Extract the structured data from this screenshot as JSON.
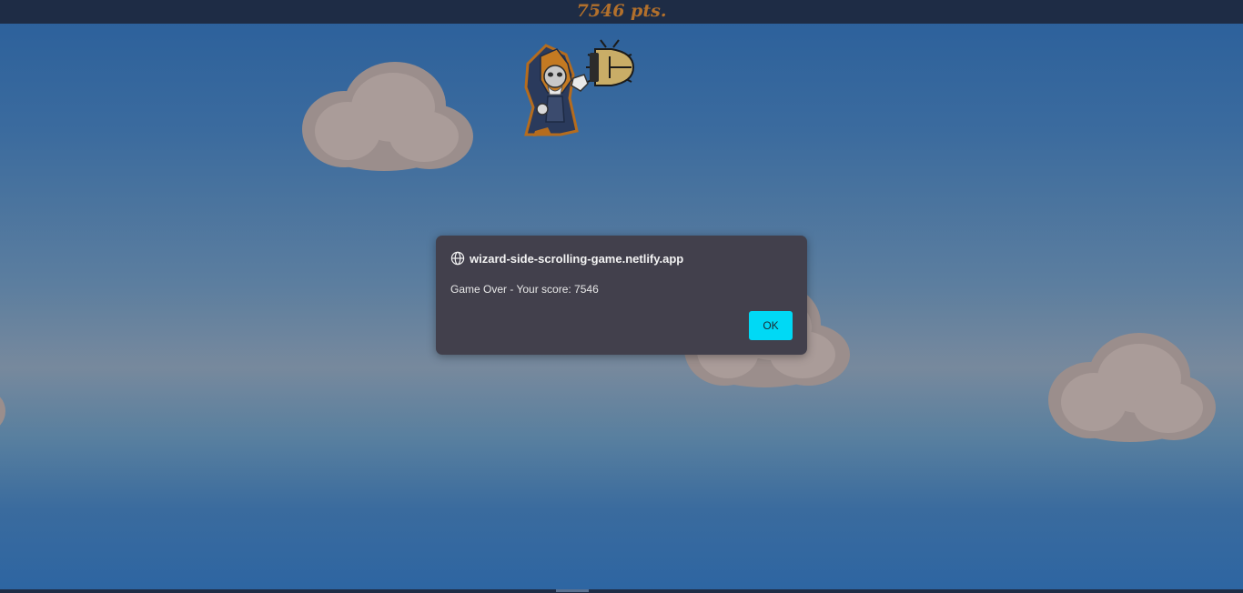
{
  "hud": {
    "score_text": "7546 pts."
  },
  "dialog": {
    "origin": "wizard-side-scrolling-game.netlify.app",
    "message": "Game Over - Your score: 7546",
    "ok_label": "OK"
  },
  "icons": {
    "dialog_icon": "globe-icon",
    "player": "wizard-icon",
    "enemy": "bug-icon"
  },
  "colors": {
    "hud_bar": "#1e2c45",
    "score_text": "#b2702c",
    "dialog_bg": "#42404c",
    "ok_button": "#00d9f5"
  }
}
